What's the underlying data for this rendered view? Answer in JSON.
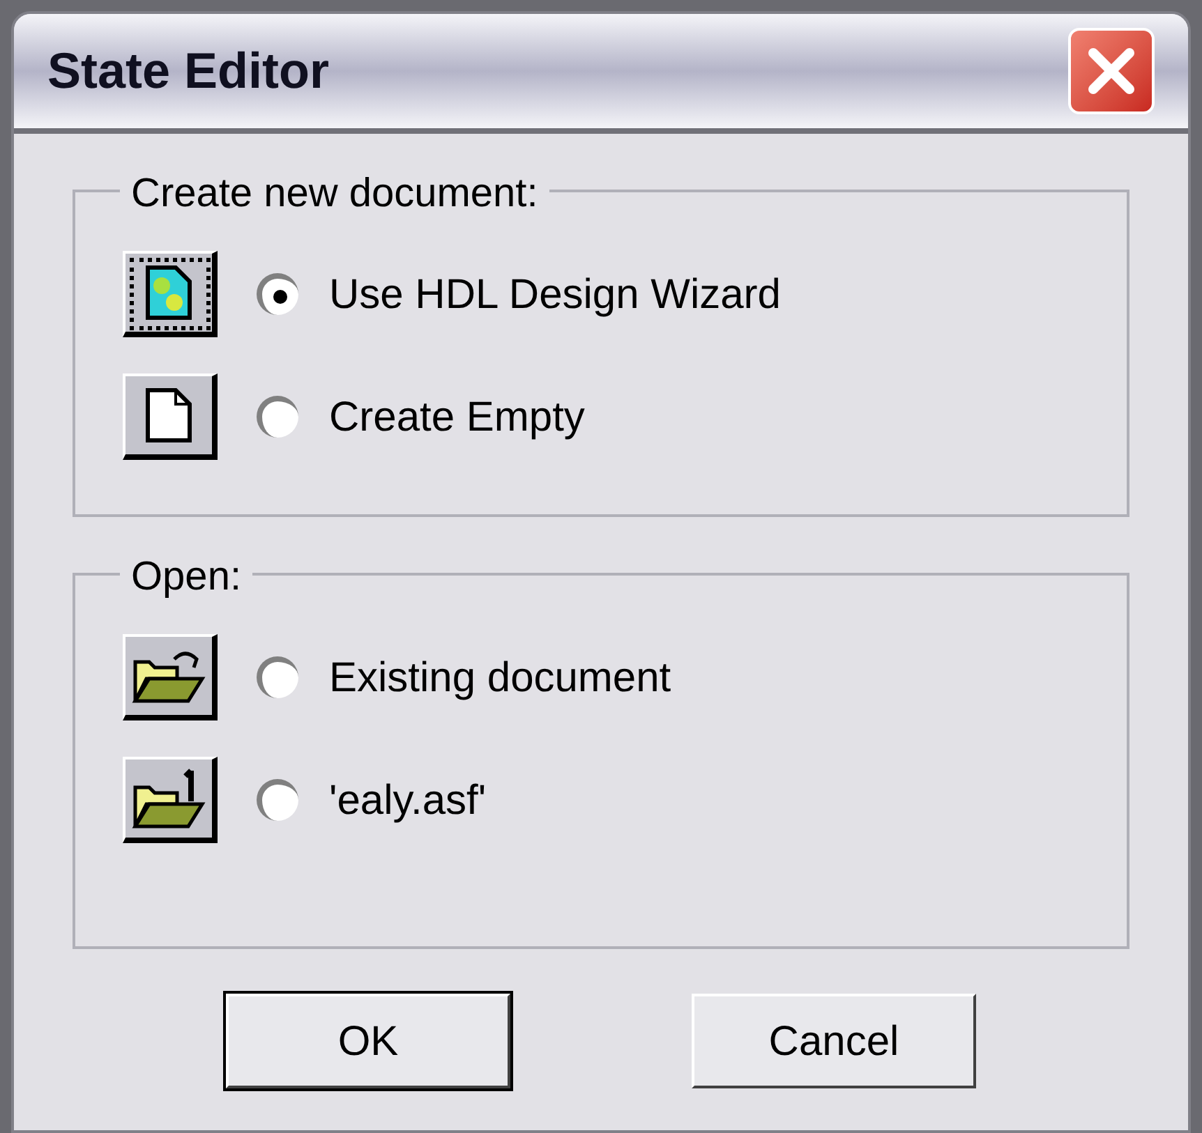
{
  "window": {
    "title": "State Editor"
  },
  "groups": [
    {
      "title": "Create new document:",
      "options": [
        {
          "label": "Use HDL Design Wizard",
          "selected": true,
          "kind": "wizard",
          "focused": true
        },
        {
          "label": "Create Empty",
          "selected": false,
          "kind": "blank",
          "focused": false
        }
      ]
    },
    {
      "title": "Open:",
      "options": [
        {
          "label": "Existing document",
          "selected": false,
          "kind": "open",
          "focused": false
        },
        {
          "label": "'ealy.asf'",
          "selected": false,
          "kind": "recent",
          "focused": false
        }
      ]
    }
  ],
  "buttons": [
    {
      "label": "OK",
      "default": true
    },
    {
      "label": "Cancel",
      "default": false
    }
  ]
}
